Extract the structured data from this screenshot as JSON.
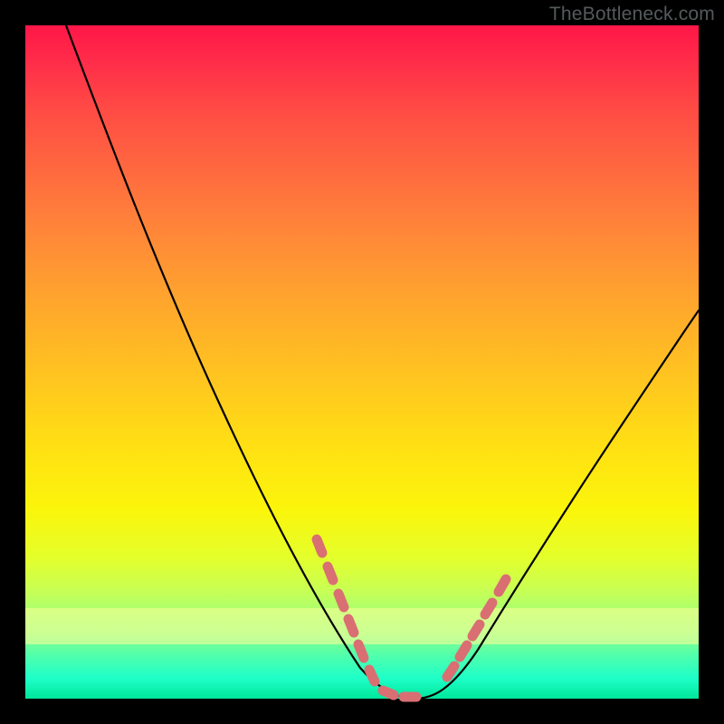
{
  "watermark": "TheBottleneck.com",
  "chart_data": {
    "type": "line",
    "title": "",
    "xlabel": "",
    "ylabel": "",
    "xlim": [
      0,
      100
    ],
    "ylim": [
      0,
      100
    ],
    "grid": false,
    "series": [
      {
        "name": "curve",
        "x": [
          6,
          10,
          15,
          20,
          25,
          30,
          35,
          40,
          45,
          48,
          50,
          52,
          55,
          58,
          60,
          65,
          70,
          75,
          80,
          85,
          90,
          95,
          100
        ],
        "values": [
          100,
          91,
          80,
          69,
          59,
          49,
          40,
          30,
          19,
          10,
          4,
          1,
          0,
          0,
          1,
          7,
          15,
          24,
          32,
          40,
          47,
          54,
          60
        ]
      }
    ],
    "markers": {
      "name": "highlight-points",
      "color": "#d96f72",
      "x": [
        44,
        45.5,
        47,
        48,
        49.5,
        51,
        53,
        56,
        58,
        63,
        65,
        66.5,
        68,
        69.5
      ],
      "values": [
        22,
        18,
        14,
        10,
        7,
        3,
        1,
        0,
        0,
        4,
        8,
        11,
        13,
        15
      ]
    },
    "background_gradient": {
      "top": "#ff1648",
      "mid": "#ffe113",
      "bottom": "#00e69a"
    },
    "highlight_band": {
      "ymin": 8,
      "ymax": 14,
      "color": "#ffff99"
    }
  }
}
